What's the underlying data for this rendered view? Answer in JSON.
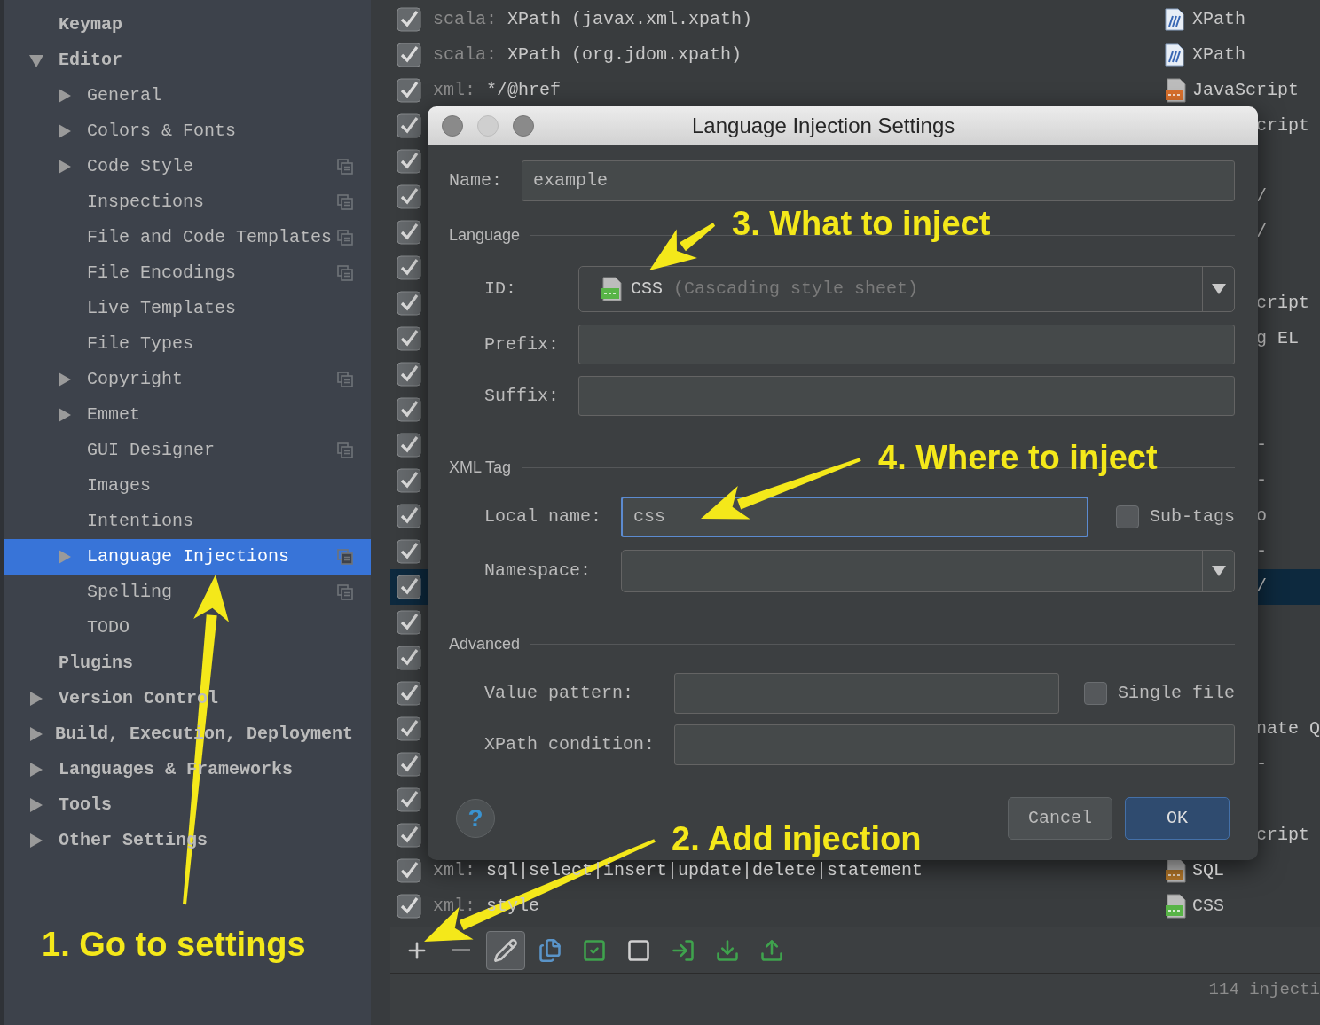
{
  "sidebar": {
    "items": [
      {
        "label": "Keymap",
        "selected": false,
        "project_icon": false
      },
      {
        "label": "Editor",
        "expanded": true,
        "selected": false,
        "project_icon": false,
        "children": [
          {
            "label": "General",
            "expanded": false,
            "selected": false,
            "project_icon": false
          },
          {
            "label": "Colors & Fonts",
            "expanded": false,
            "selected": false,
            "project_icon": false
          },
          {
            "label": "Code Style",
            "expanded": false,
            "selected": false,
            "project_icon": true
          },
          {
            "label": "Inspections",
            "selected": false,
            "project_icon": true
          },
          {
            "label": "File and Code Templates",
            "selected": false,
            "project_icon": true
          },
          {
            "label": "File Encodings",
            "selected": false,
            "project_icon": true
          },
          {
            "label": "Live Templates",
            "selected": false,
            "project_icon": false
          },
          {
            "label": "File Types",
            "selected": false,
            "project_icon": false
          },
          {
            "label": "Copyright",
            "expanded": false,
            "selected": false,
            "project_icon": true
          },
          {
            "label": "Emmet",
            "expanded": false,
            "selected": false,
            "project_icon": false
          },
          {
            "label": "GUI Designer",
            "selected": false,
            "project_icon": true
          },
          {
            "label": "Images",
            "selected": false,
            "project_icon": false
          },
          {
            "label": "Intentions",
            "selected": false,
            "project_icon": false
          },
          {
            "label": "Language Injections",
            "expanded": false,
            "selected": true,
            "project_icon": true
          },
          {
            "label": "Spelling",
            "selected": false,
            "project_icon": true
          },
          {
            "label": "TODO",
            "selected": false,
            "project_icon": false
          }
        ]
      },
      {
        "label": "Plugins",
        "selected": false,
        "project_icon": false
      },
      {
        "label": "Version Control",
        "expanded": false,
        "selected": false,
        "project_icon": false
      },
      {
        "label": "Build, Execution, Deployment",
        "expanded": false,
        "selected": false,
        "project_icon": false
      },
      {
        "label": "Languages & Frameworks",
        "expanded": false,
        "selected": false,
        "project_icon": false
      },
      {
        "label": "Tools",
        "expanded": false,
        "selected": false,
        "project_icon": false
      },
      {
        "label": "Other Settings",
        "expanded": false,
        "selected": false,
        "project_icon": false
      }
    ]
  },
  "injections": {
    "rows": [
      {
        "checked": true,
        "selected": false,
        "prefix": "scala:",
        "text": "XPath (javax.xml.xpath)",
        "language": "XPath",
        "kind": "xpath"
      },
      {
        "checked": true,
        "selected": false,
        "prefix": "scala:",
        "text": "XPath (org.jdom.xpath)",
        "language": "XPath",
        "kind": "xpath"
      },
      {
        "checked": true,
        "selected": false,
        "prefix": "xml:",
        "text": "*/@href",
        "language": "JavaScript",
        "kind": "js"
      },
      {
        "checked": true,
        "selected": false,
        "tail": "cript"
      },
      {
        "checked": true,
        "selected": false
      },
      {
        "checked": true,
        "selected": false,
        "tail": "/"
      },
      {
        "checked": true,
        "selected": false,
        "tail": "/"
      },
      {
        "checked": true,
        "selected": false
      },
      {
        "checked": true,
        "selected": false,
        "tail": "cript"
      },
      {
        "checked": true,
        "selected": false,
        "tail": "g EL"
      },
      {
        "checked": true,
        "selected": false
      },
      {
        "checked": true,
        "selected": false
      },
      {
        "checked": true,
        "selected": false,
        "tail": "-"
      },
      {
        "checked": true,
        "selected": false,
        "tail": "-"
      },
      {
        "checked": true,
        "selected": false,
        "tail": "o"
      },
      {
        "checked": true,
        "selected": false,
        "tail": "-"
      },
      {
        "checked": true,
        "selected": true,
        "tail": "/"
      },
      {
        "checked": true,
        "selected": false
      },
      {
        "checked": true,
        "selected": false
      },
      {
        "checked": true,
        "selected": false
      },
      {
        "checked": true,
        "selected": false,
        "tail": "nate Q"
      },
      {
        "checked": true,
        "selected": false,
        "tail": "-"
      },
      {
        "checked": true,
        "selected": false
      },
      {
        "checked": true,
        "selected": false,
        "tail": "cript"
      },
      {
        "checked": true,
        "selected": false,
        "prefix": "xml:",
        "text": "sql|select|insert|update|delete|statement",
        "language": "SQL",
        "kind": "sql"
      },
      {
        "checked": true,
        "selected": false,
        "prefix": "xml:",
        "text": "style",
        "language": "CSS",
        "kind": "css"
      }
    ],
    "toolbar": [
      {
        "kind": "add",
        "pressed": false,
        "disabled": false
      },
      {
        "kind": "remove",
        "pressed": false,
        "disabled": true
      },
      {
        "kind": "edit",
        "pressed": true,
        "disabled": false
      },
      {
        "kind": "copy",
        "pressed": false,
        "disabled": false
      },
      {
        "kind": "enable",
        "pressed": false,
        "disabled": false
      },
      {
        "kind": "disable",
        "pressed": false,
        "disabled": false
      },
      {
        "kind": "import",
        "pressed": false,
        "disabled": false
      },
      {
        "kind": "save",
        "pressed": false,
        "disabled": false
      },
      {
        "kind": "export",
        "pressed": false,
        "disabled": false
      }
    ],
    "status": "114 injecti"
  },
  "dialog": {
    "title": "Language Injection Settings",
    "window_controls": [
      {
        "disabled": false
      },
      {
        "disabled": true
      },
      {
        "disabled": false
      }
    ],
    "name": {
      "label": "Name:",
      "value": "example",
      "focused": false
    },
    "language": {
      "heading": "Language",
      "id": {
        "label": "ID:",
        "value": "CSS",
        "description": "(Cascading style sheet)"
      },
      "prefix": {
        "label": "Prefix:",
        "focused": false
      },
      "suffix": {
        "label": "Suffix:",
        "focused": false
      }
    },
    "xml_tag": {
      "heading": "XML Tag",
      "local_name": {
        "label": "Local name:",
        "value": "css",
        "focused": true
      },
      "sub_tags": {
        "label": "Sub-tags",
        "checked": false
      },
      "namespace": {
        "label": "Namespace:"
      }
    },
    "advanced": {
      "heading": "Advanced",
      "value_pattern": {
        "label": "Value pattern:",
        "focused": false
      },
      "single_file": {
        "label": "Single file",
        "checked": false
      },
      "xpath_condition": {
        "label": "XPath condition:",
        "focused": false
      }
    },
    "help_button": "?",
    "buttons": [
      {
        "label": "Cancel",
        "default": false
      },
      {
        "label": "OK",
        "default": true
      }
    ]
  },
  "annotations": [
    {
      "text": "3. What to inject"
    },
    {
      "text": "4. Where to inject"
    },
    {
      "text": "2. Add injection"
    },
    {
      "text": "1. Go to settings"
    }
  ]
}
